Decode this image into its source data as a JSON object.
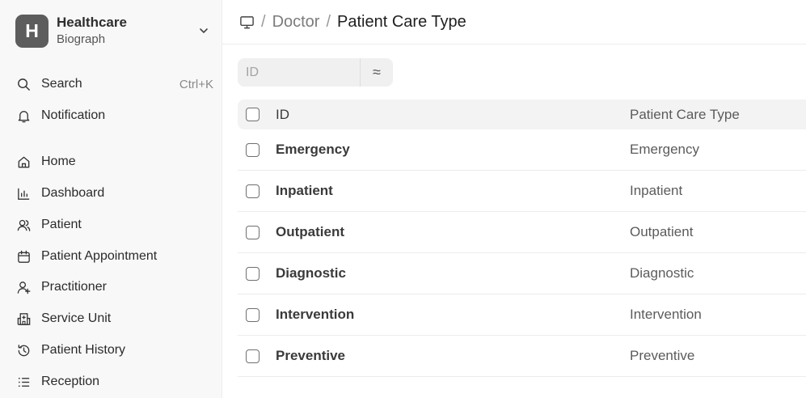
{
  "brand": {
    "letter": "H",
    "title": "Healthcare",
    "subtitle": "Biograph"
  },
  "sidebar": {
    "search": {
      "label": "Search",
      "shortcut": "Ctrl+K"
    },
    "notification": {
      "label": "Notification"
    },
    "items": [
      {
        "label": "Home",
        "icon": "home-icon"
      },
      {
        "label": "Dashboard",
        "icon": "bar-chart-icon"
      },
      {
        "label": "Patient",
        "icon": "users-icon"
      },
      {
        "label": "Patient Appointment",
        "icon": "calendar-icon"
      },
      {
        "label": "Practitioner",
        "icon": "user-plus-icon"
      },
      {
        "label": "Service Unit",
        "icon": "hospital-icon"
      },
      {
        "label": "Patient History",
        "icon": "history-icon"
      },
      {
        "label": "Reception",
        "icon": "list-icon"
      }
    ]
  },
  "breadcrumb": {
    "sep": "/",
    "parent": "Doctor",
    "current": "Patient Care Type"
  },
  "filter": {
    "placeholder": "ID",
    "operator": "≈"
  },
  "table": {
    "headers": {
      "id": "ID",
      "type": "Patient Care Type"
    },
    "rows": [
      {
        "id": "Emergency",
        "type": "Emergency"
      },
      {
        "id": "Inpatient",
        "type": "Inpatient"
      },
      {
        "id": "Outpatient",
        "type": "Outpatient"
      },
      {
        "id": "Diagnostic",
        "type": "Diagnostic"
      },
      {
        "id": "Intervention",
        "type": "Intervention"
      },
      {
        "id": "Preventive",
        "type": "Preventive"
      }
    ]
  }
}
